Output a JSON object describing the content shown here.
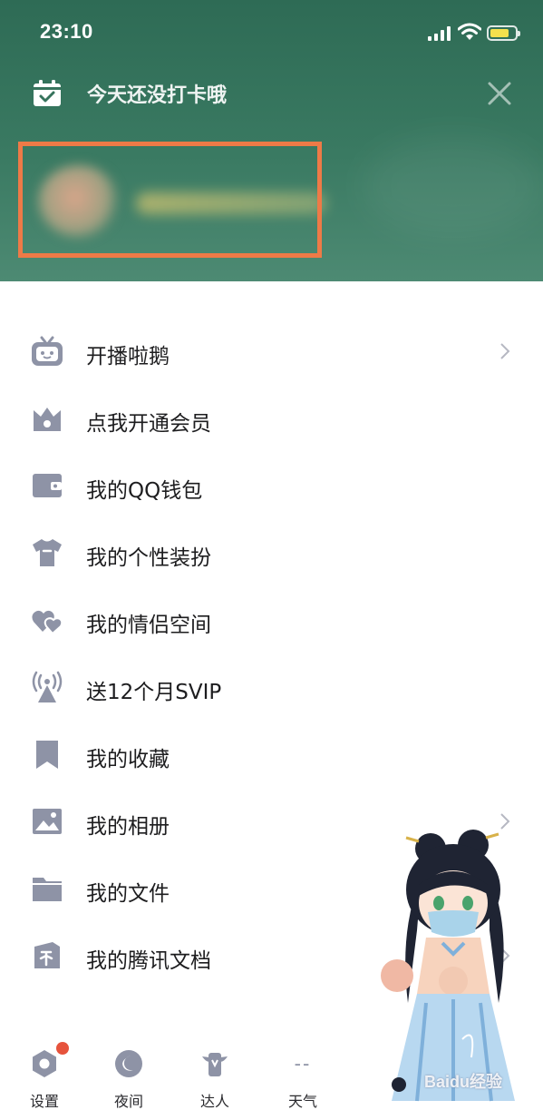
{
  "status_bar": {
    "time": "23:10"
  },
  "header": {
    "checkin_text": "今天还没打卡哦",
    "colors": {
      "background": "#36735c",
      "highlight_box": "#ee7a47"
    }
  },
  "menu": {
    "items": [
      {
        "label": "开播啦鹅",
        "icon": "tv-icon",
        "chevron": true
      },
      {
        "label": "点我开通会员",
        "icon": "crown-icon",
        "chevron": false
      },
      {
        "label": "我的QQ钱包",
        "icon": "wallet-icon",
        "chevron": false
      },
      {
        "label": "我的个性装扮",
        "icon": "tshirt-icon",
        "chevron": false
      },
      {
        "label": "我的情侣空间",
        "icon": "hearts-icon",
        "chevron": false
      },
      {
        "label": "送12个月SVIP",
        "icon": "broadcast-icon",
        "chevron": false
      },
      {
        "label": "我的收藏",
        "icon": "bookmark-icon",
        "chevron": false
      },
      {
        "label": "我的相册",
        "icon": "photo-icon",
        "chevron": true
      },
      {
        "label": "我的文件",
        "icon": "folder-icon",
        "chevron": false
      },
      {
        "label": "我的腾讯文档",
        "icon": "tencent-docs-icon",
        "chevron": true
      }
    ]
  },
  "footer": {
    "settings": "设置",
    "night": "夜间",
    "expert": "达人",
    "weather": "天气",
    "weather_value": "--"
  },
  "watermark": "Baidu经验"
}
